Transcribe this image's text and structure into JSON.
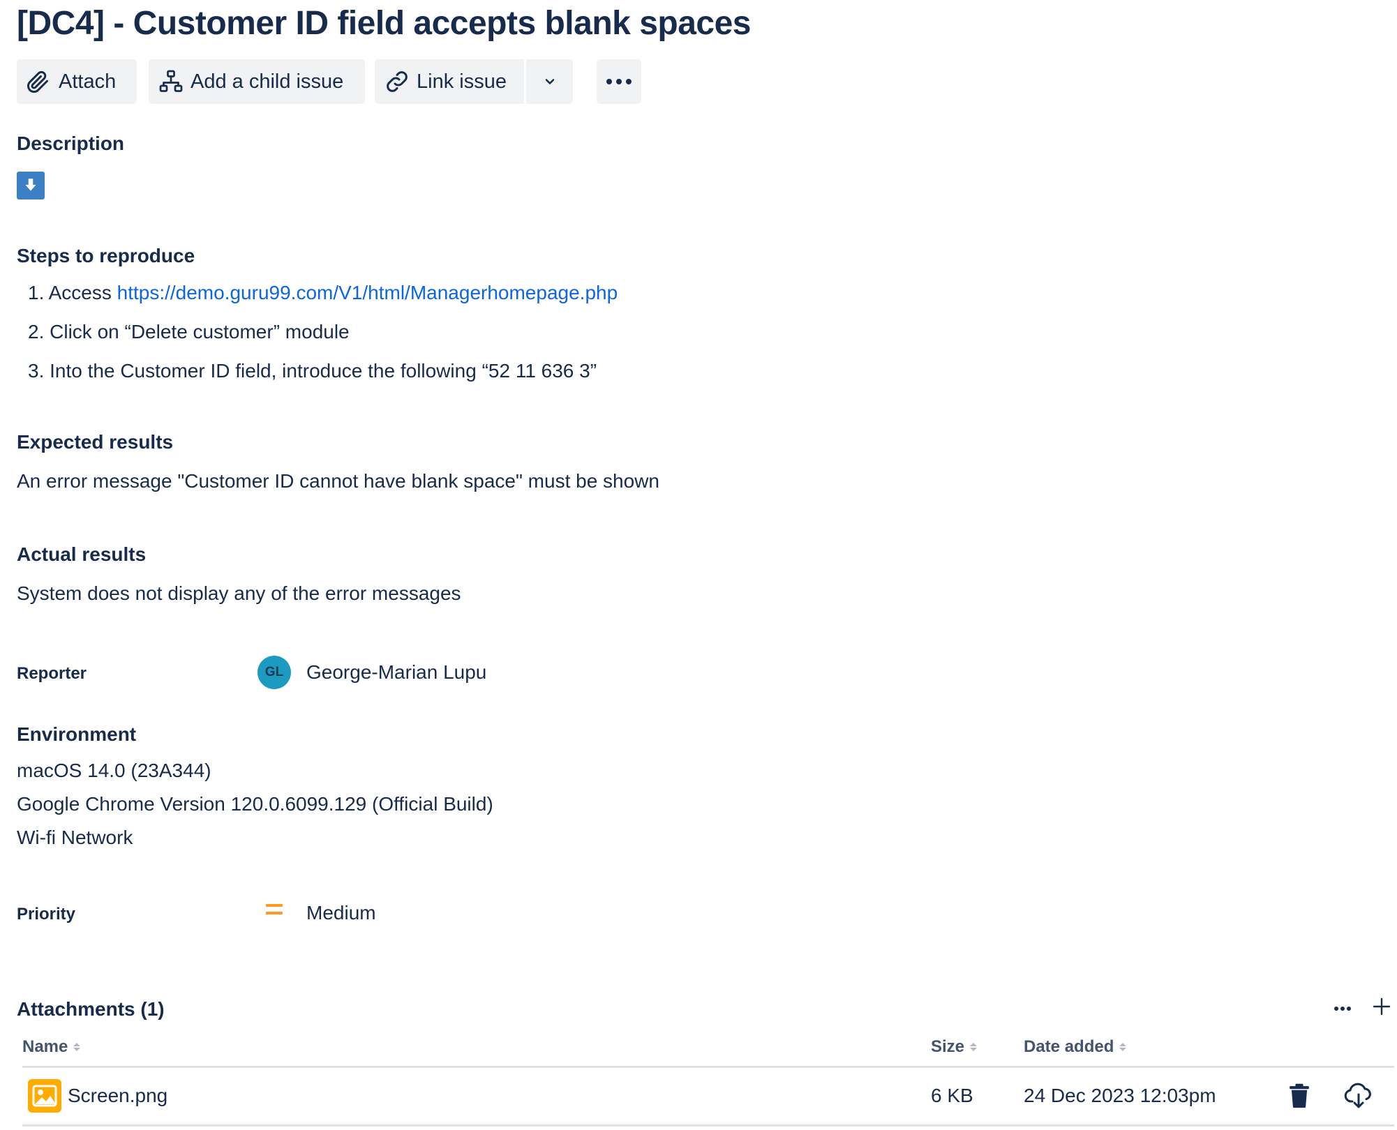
{
  "issue": {
    "title": "[DC4] - Customer ID field accepts blank spaces"
  },
  "toolbar": {
    "attach": "Attach",
    "add_child": "Add a child issue",
    "link_issue": "Link issue",
    "icons": [
      "paperclip-icon",
      "hierarchy-icon",
      "link-icon",
      "chevron-down-icon",
      "more-icon"
    ]
  },
  "description": {
    "heading": "Description",
    "icon": "download-arrow-icon",
    "steps_heading": "Steps to reproduce",
    "steps": [
      {
        "num": "1.",
        "prefix": "Access ",
        "link": "https://demo.guru99.com/V1/html/Managerhomepage.php"
      },
      {
        "num": "2.",
        "text": "Click on “Delete customer” module"
      },
      {
        "num": "3.",
        "text": "Into the Customer ID field, introduce the following “52 11 636 3”"
      }
    ],
    "expected_heading": "Expected results",
    "expected_text": "An error message \"Customer ID cannot have blank space\" must be shown",
    "actual_heading": "Actual results",
    "actual_text": "System does not display any of the error messages"
  },
  "reporter": {
    "label": "Reporter",
    "initials": "GL",
    "name": "George-Marian Lupu",
    "avatar_color": "#1d9ac1"
  },
  "environment": {
    "heading": "Environment",
    "lines": [
      "macOS 14.0 (23A344)",
      "Google Chrome Version 120.0.6099.129 (Official Build)",
      "Wi-fi Network"
    ]
  },
  "priority": {
    "label": "Priority",
    "value": "Medium",
    "color": "#ff991f"
  },
  "attachments": {
    "heading": "Attachments (1)",
    "columns": {
      "name": "Name",
      "size": "Size",
      "date": "Date added"
    },
    "rows": [
      {
        "name": "Screen.png",
        "size": "6 KB",
        "date": "24 Dec 2023 12:03pm",
        "icon": "image-file-icon"
      }
    ]
  },
  "colors": {
    "text": "#172b4d",
    "link": "#0c66e4",
    "button_bg": "#f1f2f4",
    "subtle_text": "#44546f"
  }
}
